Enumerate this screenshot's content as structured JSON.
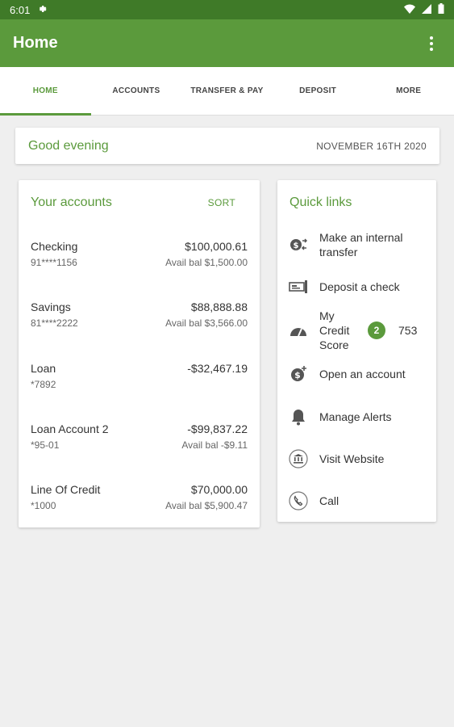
{
  "status_bar": {
    "time": "6:01"
  },
  "app_bar": {
    "title": "Home"
  },
  "tabs": [
    {
      "label": "HOME",
      "active": true
    },
    {
      "label": "ACCOUNTS"
    },
    {
      "label": "TRANSFER & PAY"
    },
    {
      "label": "DEPOSIT"
    },
    {
      "label": "MORE"
    }
  ],
  "greeting": {
    "text": "Good evening",
    "date": "NOVEMBER 16TH 2020"
  },
  "accounts": {
    "title": "Your accounts",
    "sort_label": "SORT",
    "items": [
      {
        "name": "Checking",
        "number": "91****1156",
        "balance": "$100,000.61",
        "avail": "Avail bal $1,500.00"
      },
      {
        "name": "Savings",
        "number": "81****2222",
        "balance": "$88,888.88",
        "avail": "Avail bal $3,566.00"
      },
      {
        "name": "Loan",
        "number": "*7892",
        "balance": "-$32,467.19",
        "avail": ""
      },
      {
        "name": "Loan Account 2",
        "number": "*95-01",
        "balance": "-$99,837.22",
        "avail": "Avail bal -$9.11"
      },
      {
        "name": "Line Of Credit",
        "number": "*1000",
        "balance": "$70,000.00",
        "avail": "Avail bal $5,900.47"
      }
    ]
  },
  "quick_links": {
    "title": "Quick links",
    "items": [
      {
        "label": "Make an internal transfer",
        "icon": "transfer-money-icon"
      },
      {
        "label": "Deposit a check",
        "icon": "check-deposit-icon"
      },
      {
        "label": "My Credit Score",
        "icon": "gauge-icon",
        "badge": "2",
        "score": "753"
      },
      {
        "label": "Open an account",
        "icon": "add-money-icon"
      },
      {
        "label": "Manage Alerts",
        "icon": "bell-icon"
      },
      {
        "label": "Visit Website",
        "icon": "bank-icon"
      },
      {
        "label": "Call",
        "icon": "phone-icon"
      }
    ]
  },
  "colors": {
    "primary": "#5b9a3c",
    "status_bar": "#3f7a28",
    "background": "#efefef"
  }
}
